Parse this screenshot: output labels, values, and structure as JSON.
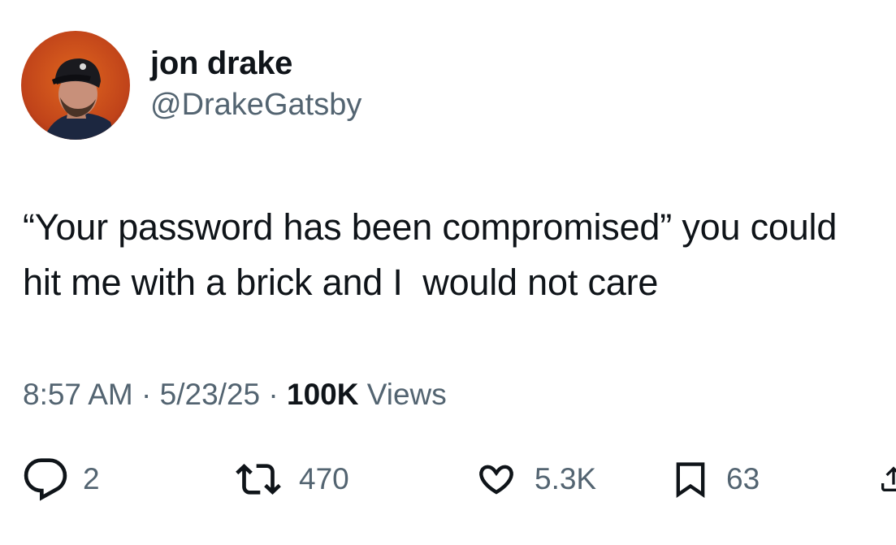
{
  "author": {
    "display_name": "jon drake",
    "handle": "@DrakeGatsby"
  },
  "tweet": {
    "text": "“Your password has been compromised” you could hit me with a brick and I  would not care"
  },
  "meta": {
    "time": "8:57 AM",
    "separator": "·",
    "date": "5/23/25",
    "views_count": "100K",
    "views_label": "Views"
  },
  "actions": {
    "replies": "2",
    "reposts": "470",
    "likes": "5.3K",
    "bookmarks": "63"
  },
  "icons": {
    "reply": "reply-icon",
    "repost": "repost-icon",
    "like": "heart-icon",
    "bookmark": "bookmark-icon",
    "share": "share-icon"
  },
  "colors": {
    "text_primary": "#0f1419",
    "text_secondary": "#536471",
    "avatar_bg": "#c4441a"
  }
}
